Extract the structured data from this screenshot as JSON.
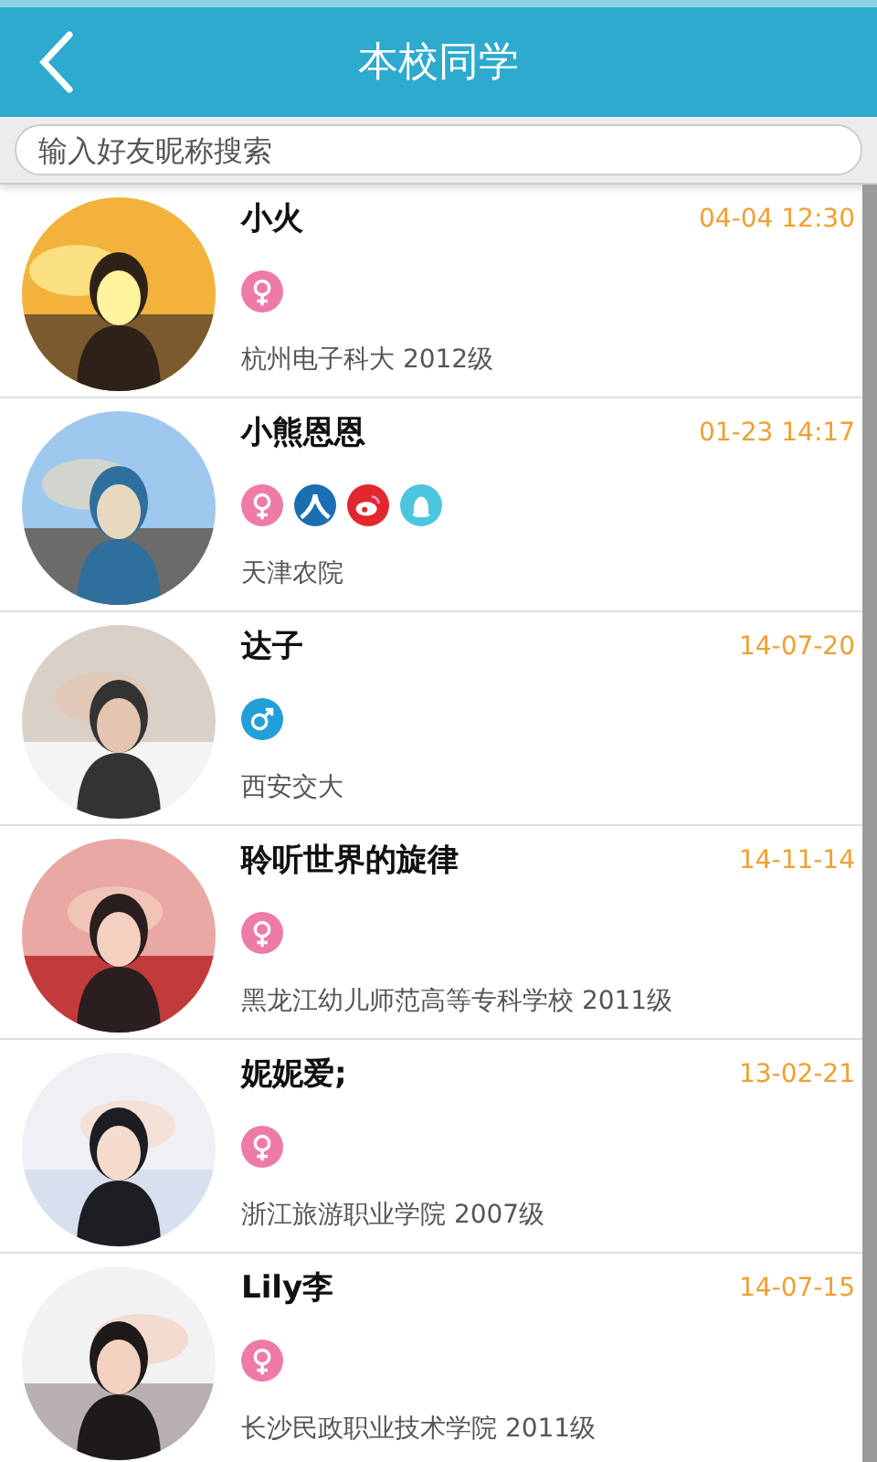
{
  "header": {
    "title": "本校同学"
  },
  "search": {
    "placeholder": "输入好友昵称搜索"
  },
  "contacts": [
    {
      "name": "小火",
      "time": "04-04 12:30",
      "school": "杭州电子科大 2012级",
      "badges": [
        {
          "kind": "female"
        }
      ]
    },
    {
      "name": "小熊恩恩",
      "time": "01-23 14:17",
      "school": "天津农院",
      "badges": [
        {
          "kind": "female"
        },
        {
          "kind": "renren"
        },
        {
          "kind": "weibo"
        },
        {
          "kind": "qq"
        }
      ]
    },
    {
      "name": "达子",
      "time": "14-07-20",
      "school": "西安交大",
      "badges": [
        {
          "kind": "male"
        }
      ]
    },
    {
      "name": "聆听世界的旋律",
      "time": "14-11-14",
      "school": "黑龙江幼儿师范高等专科学校 2011级",
      "badges": [
        {
          "kind": "female"
        }
      ]
    },
    {
      "name": "妮妮爱;",
      "time": "13-02-21",
      "school": "浙江旅游职业学院 2007级",
      "badges": [
        {
          "kind": "female"
        }
      ]
    },
    {
      "name": "Lily李",
      "time": "14-07-15",
      "school": "长沙民政职业技术学院 2011级",
      "badges": [
        {
          "kind": "female"
        }
      ]
    }
  ]
}
